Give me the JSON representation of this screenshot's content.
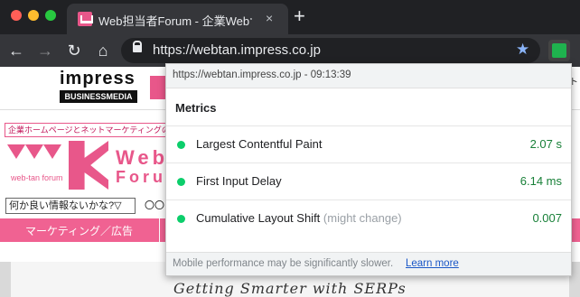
{
  "browser": {
    "tab_title": "Web担当者Forum - 企業Webサイ",
    "tab_close": "×",
    "new_tab": "+",
    "url": "https://webtan.impress.co.jp",
    "icons": [
      "back-arrow-icon",
      "forward-arrow-icon",
      "reload-icon",
      "home-icon",
      "lock-icon",
      "star-icon",
      "extension-icon"
    ],
    "traffic_colors": [
      "#ff5f57",
      "#febc2e",
      "#28c840"
    ]
  },
  "page": {
    "logo_text": "impress",
    "logo_sub": "BUSINESSMEDIA",
    "banner": "企業ホームページとネットマーケティングの実践",
    "forum_web": "Web",
    "forum_sub_word": "Foru",
    "forum_tagline": "web-tan forum",
    "search_text": "何か良い情報ないかな?▽",
    "search_text2": "〇〇",
    "nav_item": "マーケティング／広告",
    "right_edge_text": "ト",
    "handwriting": "Getting Smarter with SERPs",
    "brand_pink": "#e8578a"
  },
  "popup": {
    "header": "https://webtan.impress.co.jp - 09:13:39",
    "title": "Metrics",
    "metrics": [
      {
        "name": "Largest Contentful Paint",
        "note": "",
        "value": "2.07 s",
        "status_color": "#0cce6b"
      },
      {
        "name": "First Input Delay",
        "note": "",
        "value": "6.14 ms",
        "status_color": "#0cce6b"
      },
      {
        "name": "Cumulative Layout Shift",
        "note": "(might change)",
        "value": "0.007",
        "status_color": "#0cce6b"
      }
    ],
    "footer_note": "Mobile performance may be significantly slower.",
    "footer_link": "Learn more"
  }
}
